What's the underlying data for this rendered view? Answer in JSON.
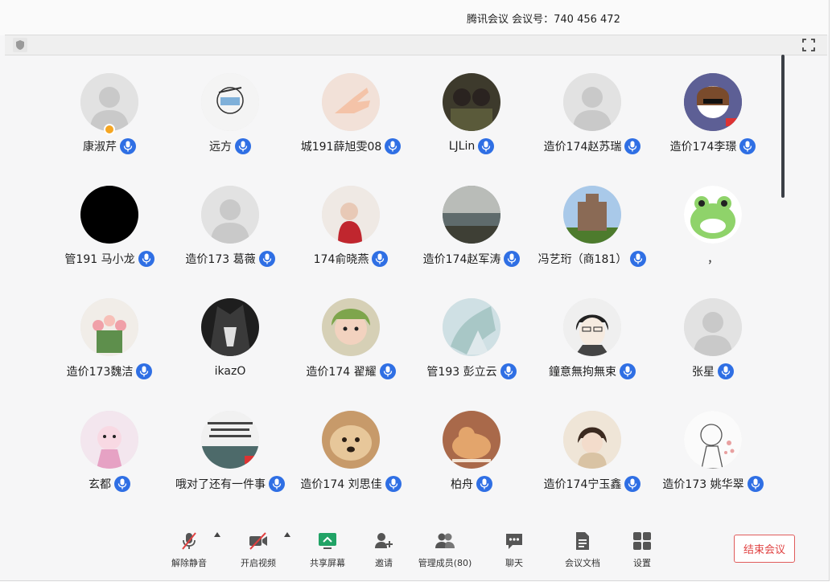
{
  "window": {
    "title": "腾讯会议  会议号：740 456 472"
  },
  "participants": [
    {
      "name": "康淑芹",
      "avatar": "default",
      "host": true
    },
    {
      "name": "远方",
      "avatar": "sketch"
    },
    {
      "name": "城191薛旭雯08",
      "avatar": "hand"
    },
    {
      "name": "LJLin",
      "avatar": "photo-dark"
    },
    {
      "name": "造价174赵苏瑞",
      "avatar": "default"
    },
    {
      "name": "造价174李璟",
      "avatar": "girl-cartoon"
    },
    {
      "name": "管191 马小龙",
      "avatar": "black"
    },
    {
      "name": "造价173 葛薇",
      "avatar": "default"
    },
    {
      "name": "174俞晓燕",
      "avatar": "child-red"
    },
    {
      "name": "造价174赵军涛",
      "avatar": "sea"
    },
    {
      "name": "冯艺珩（商181）",
      "avatar": "building"
    },
    {
      "name": "，",
      "avatar": "frog",
      "no_mic": true
    },
    {
      "name": "造价173魏洁",
      "avatar": "flowers"
    },
    {
      "name": "ikazO",
      "avatar": "anime-dark",
      "no_mic": true
    },
    {
      "name": "造价174  翟耀",
      "avatar": "baby-green"
    },
    {
      "name": "管193 彭立云",
      "avatar": "watercolor"
    },
    {
      "name": "鐘意無拘無束",
      "avatar": "anime-boy"
    },
    {
      "name": "张星",
      "avatar": "default"
    },
    {
      "name": "玄都",
      "avatar": "pink-cartoon"
    },
    {
      "name": "哦对了还有一件事",
      "avatar": "text-poster"
    },
    {
      "name": "造价174  刘思佳",
      "avatar": "dog"
    },
    {
      "name": "柏舟",
      "avatar": "cat"
    },
    {
      "name": "造价174宁玉鑫",
      "avatar": "child-beige"
    },
    {
      "name": "造价173 姚华翠",
      "avatar": "girl-sketch"
    }
  ],
  "toolbar": {
    "mute": "解除静音",
    "video": "开启视频",
    "share": "共享屏幕",
    "invite": "邀请",
    "members": "管理成员(80)",
    "chat": "聊天",
    "docs": "会议文档",
    "settings": "设置",
    "end": "结束会议"
  },
  "colors": {
    "mic_badge": "#2f6fe4",
    "end_button": "#e04141",
    "share_icon": "#21a366"
  }
}
